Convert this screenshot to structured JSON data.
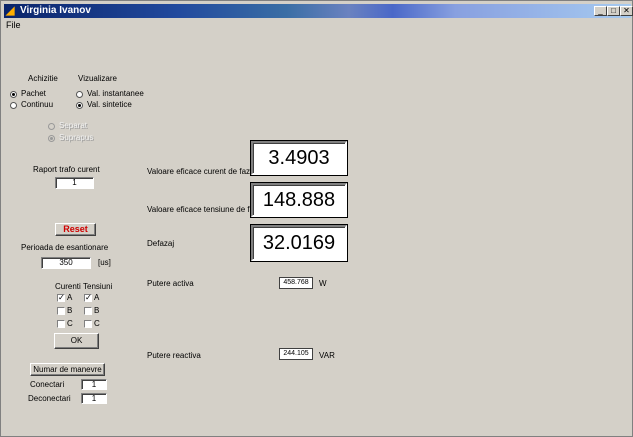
{
  "window": {
    "title": "Virginia Ivanov"
  },
  "menu": {
    "file": "File"
  },
  "achizitie": {
    "label": "Achizitie",
    "pachet": "Pachet",
    "continuu": "Continuu"
  },
  "vizualizare": {
    "label": "Vizualizare",
    "instantanee": "Val. instantanee",
    "sintetice": "Val. sintetice"
  },
  "display_mode": {
    "separat": "Separat",
    "suprapus": "Suprapus"
  },
  "raport": {
    "label": "Raport trafo curent",
    "value": "1"
  },
  "reset_label": "Reset",
  "perioada": {
    "label": "Perioada de esantionare",
    "value": "350",
    "unit": "[us]"
  },
  "curenti": {
    "label": "Curenti",
    "a": "A",
    "b": "B",
    "c": "C"
  },
  "tensiuni": {
    "label": "Tensiuni",
    "a": "A",
    "b": "B",
    "c": "C"
  },
  "ok_label": "OK",
  "manevre": {
    "button": "Numar de manevre",
    "conectari": "Conectari",
    "conectari_value": "1",
    "deconectari": "Deconectari",
    "deconectari_value": "1"
  },
  "readouts": {
    "curent": {
      "label": "Valoare eficace curent de faza",
      "value": "3.4903"
    },
    "tensiune": {
      "label": "Valoare eficace tensiune de faz",
      "value": "148.888"
    },
    "defazaj": {
      "label": "Defazaj",
      "value": "32.0169"
    },
    "activa": {
      "label": "Putere activa",
      "value": "458.768",
      "unit": "W"
    },
    "reactiva": {
      "label": "Putere reactiva",
      "value": "244.105",
      "unit": "VAR"
    }
  }
}
